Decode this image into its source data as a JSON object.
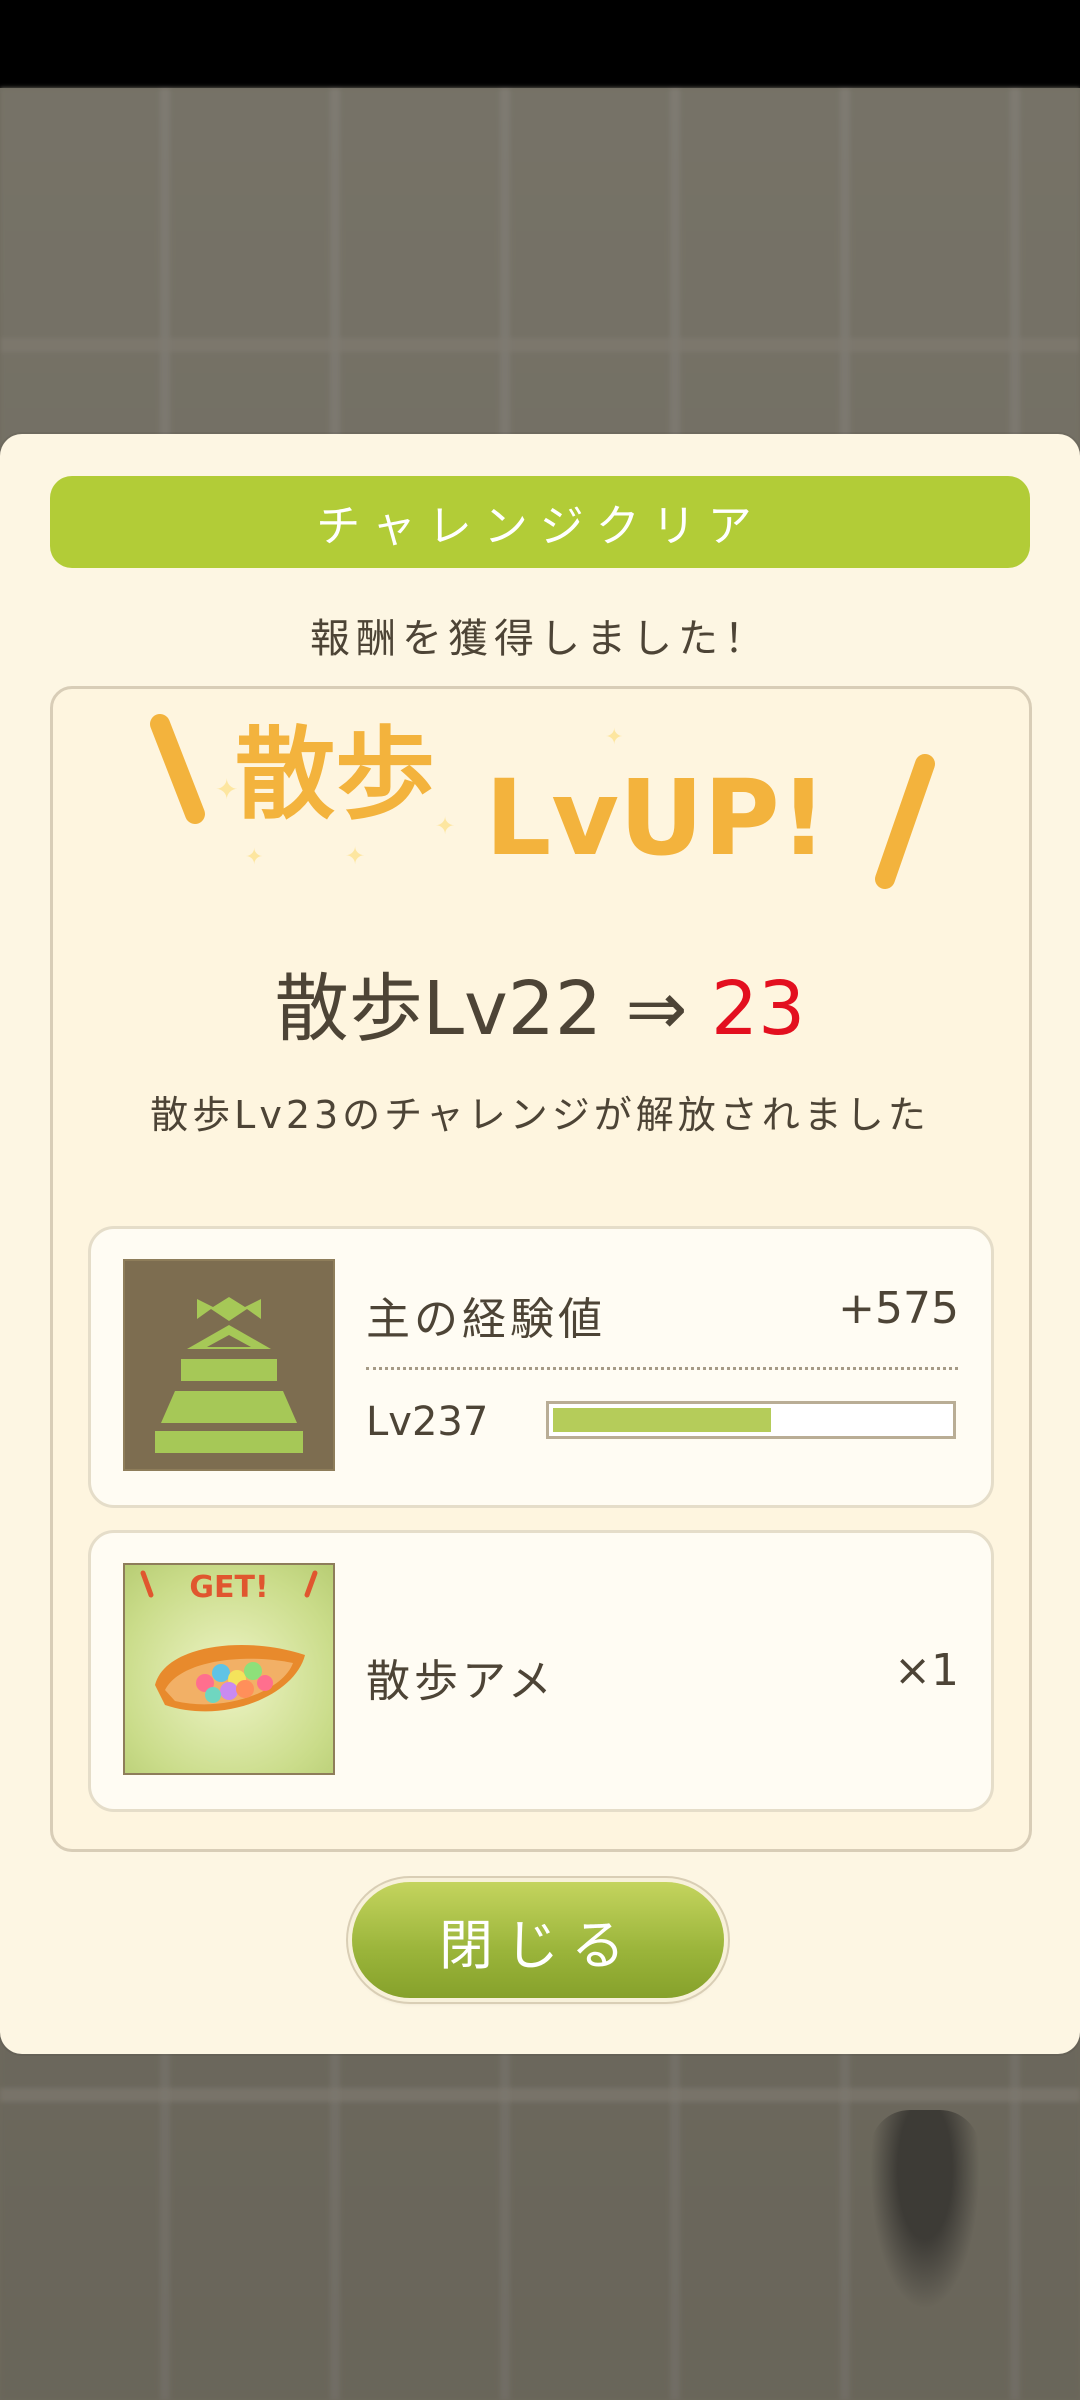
{
  "dialog": {
    "header": "チャレンジクリア",
    "subtitle": "報酬を獲得しました！",
    "banner": {
      "text_kanji": "散歩",
      "text_latin": "LvUP!"
    },
    "level_change": {
      "from": "散歩Lv22",
      "arrow": "⇒",
      "to": "23"
    },
    "unlock_message": "散歩Lv23のチャレンジが解放されました",
    "rewards": [
      {
        "label": "主の経験値",
        "value": "+575",
        "level_text": "Lv237",
        "progress": 0.55,
        "icon": "castle-icon"
      },
      {
        "label": "散歩アメ",
        "value": "×1",
        "badge": "GET!",
        "icon": "candy-plate-icon"
      }
    ],
    "close_label": "閉じる"
  },
  "colors": {
    "header_green": "#b2cc37",
    "new_level_red": "#e30f1f",
    "banner_orange": "#f3b33d",
    "text_brown": "#4d4436"
  }
}
